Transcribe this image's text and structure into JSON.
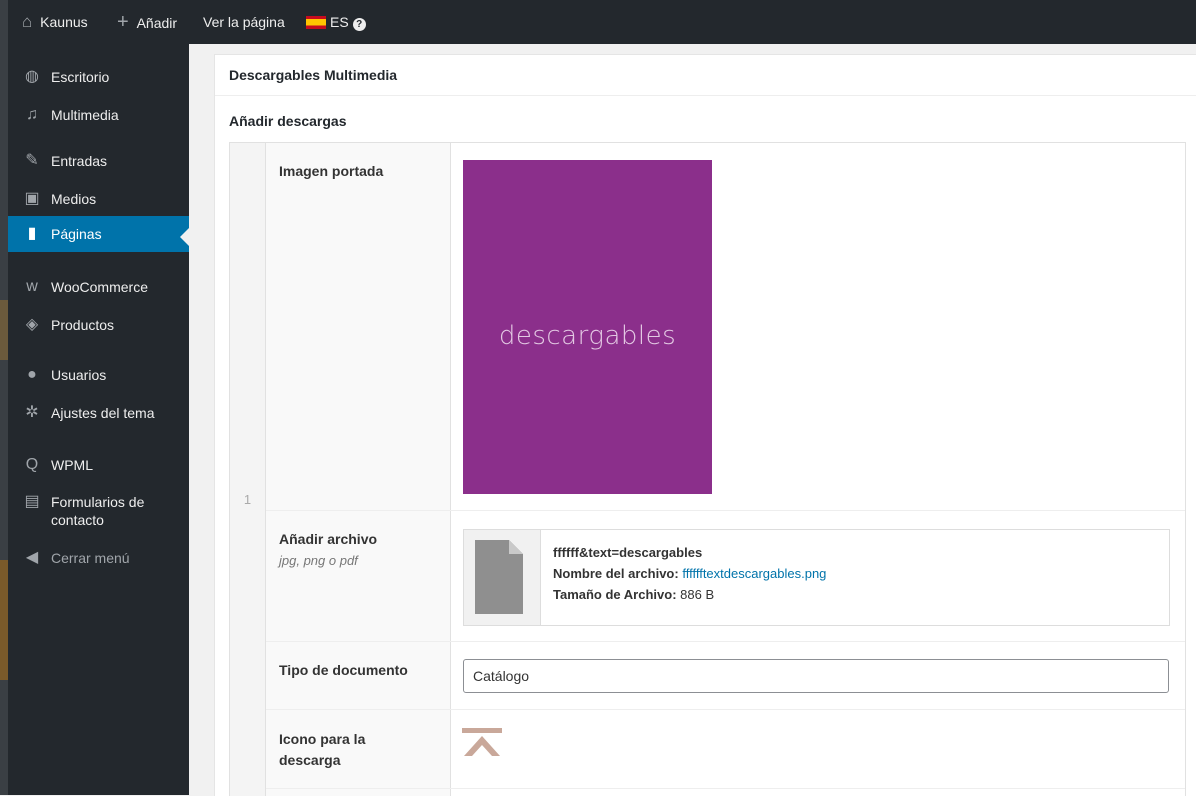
{
  "adminbar": {
    "site_name": "Kaunus",
    "add_label": "Añadir",
    "view_page_label": "Ver la página",
    "language": "ES",
    "help": "?"
  },
  "sidebar": {
    "items": [
      {
        "label": "Escritorio",
        "icon": "dashboard-icon",
        "glyph": "◍"
      },
      {
        "label": "Multimedia",
        "icon": "music-note-icon",
        "glyph": "♫"
      },
      {
        "label": "Entradas",
        "icon": "pin-icon",
        "glyph": "✎"
      },
      {
        "label": "Medios",
        "icon": "media-icon",
        "glyph": "▣"
      },
      {
        "label": "Páginas",
        "icon": "page-icon",
        "glyph": "▮"
      },
      {
        "label": "WooCommerce",
        "icon": "woo-icon",
        "glyph": "w"
      },
      {
        "label": "Productos",
        "icon": "box-icon",
        "glyph": "◈"
      },
      {
        "label": "Usuarios",
        "icon": "user-icon",
        "glyph": "●"
      },
      {
        "label": "Ajustes del tema",
        "icon": "gear-icon",
        "glyph": "✲"
      },
      {
        "label": "WPML",
        "icon": "wpml-icon",
        "glyph": "Q"
      },
      {
        "label": "Formularios de contacto",
        "icon": "form-icon",
        "glyph": "▤"
      },
      {
        "label": "Cerrar menú",
        "icon": "collapse-icon",
        "glyph": "◀"
      }
    ],
    "current": "Páginas"
  },
  "panel": {
    "title": "Descargables Multimedia",
    "field_label": "Añadir descargas"
  },
  "repeater": {
    "row_number": "1",
    "cover": {
      "label": "Imagen portada",
      "image_text": "descargables",
      "bg_color": "#8b2f8b"
    },
    "file": {
      "label": "Añadir archivo",
      "hint": "jpg, png o pdf",
      "title": "ffffff&text=descargables",
      "filename_label": "Nombre del archivo:",
      "filename": "fffffftextdescargables.png",
      "size_label": "Tamaño de Archivo:",
      "size": "886 B"
    },
    "doc_type": {
      "label": "Tipo de documento",
      "value": "Catálogo"
    },
    "download_icon": {
      "label": "Icono para la descarga",
      "icon": "download-arrow-icon"
    }
  }
}
